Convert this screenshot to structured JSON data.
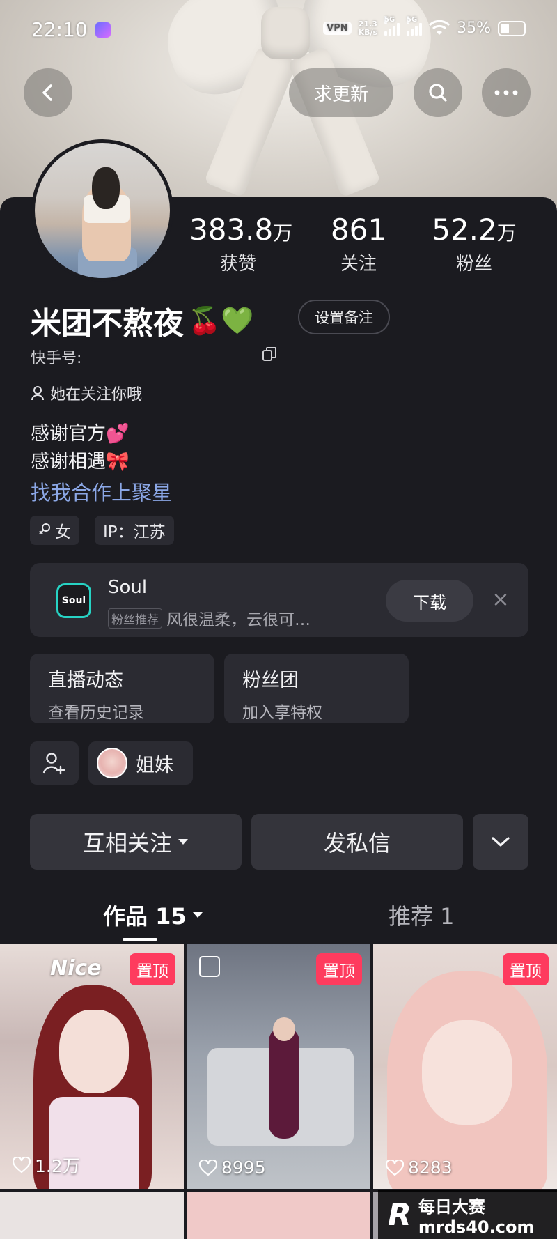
{
  "status_bar": {
    "time": "22:10",
    "vpn": "VPN",
    "net_speed_value": "21.3",
    "net_speed_unit": "KB/s",
    "sim1": "5G",
    "sim2": "5G",
    "battery": "35%"
  },
  "top_bar": {
    "update_label": "求更新"
  },
  "profile": {
    "name": "米团不熬夜",
    "name_emojis": "🍒💚",
    "note_button": "设置备注",
    "id_label": "快手号:",
    "follows_you": "她在关注你哦",
    "bio_lines": [
      "感谢官方💕",
      "感谢相遇🎀"
    ],
    "collab_link": "找我合作上聚星",
    "tags": [
      "女",
      "IP：江苏"
    ],
    "gender_icon": "female-symbol"
  },
  "stats": [
    {
      "num": "383.8",
      "unit": "万",
      "label": "获赞"
    },
    {
      "num": "861",
      "unit": "",
      "label": "关注"
    },
    {
      "num": "52.2",
      "unit": "万",
      "label": "粉丝"
    }
  ],
  "ad": {
    "logo_text": "Soul",
    "title": "Soul",
    "chip": "粉丝推荐",
    "subtitle": "风很温柔，云很可…",
    "download": "下载",
    "close": "×"
  },
  "cards": [
    {
      "title": "直播动态",
      "subtitle": "查看历史记录"
    },
    {
      "title": "粉丝团",
      "subtitle": "加入享特权"
    }
  ],
  "relation": {
    "sister_label": "姐妹"
  },
  "actions": {
    "mutual_follow": "互相关注",
    "message": "发私信"
  },
  "tabs": {
    "works": "作品 15",
    "recommend": "推荐 1"
  },
  "grid": [
    {
      "pinned": "置顶",
      "likes": "1.2万",
      "overlay_text": "Nice"
    },
    {
      "pinned": "置顶",
      "likes": "8995"
    },
    {
      "pinned": "置顶",
      "likes": "8283"
    }
  ],
  "watermark": {
    "logo": "R",
    "line1": "每日大赛",
    "line2": "mrds40.com"
  }
}
